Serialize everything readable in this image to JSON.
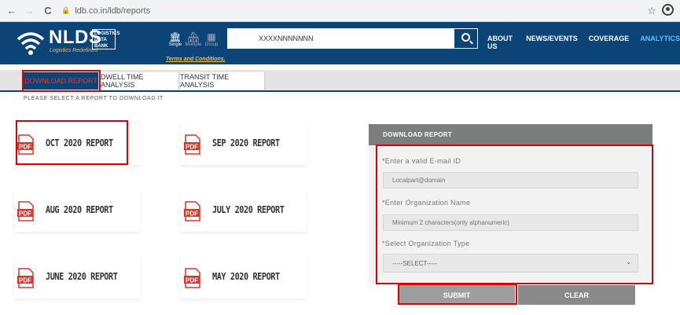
{
  "browser": {
    "back": "←",
    "forward": "→",
    "reload": "C",
    "url": "ldb.co.in/ldb/reports",
    "star": "☆"
  },
  "header": {
    "logo_text": "NLDS",
    "logo_tagline": "Logistics Redefined",
    "logo_box_lines": [
      "LOGISTICS",
      "DATA",
      "BANK"
    ],
    "modes": [
      {
        "label": "Single",
        "icon": "building-icon"
      },
      {
        "label": "Multiple",
        "icon": "buildings-icon"
      },
      {
        "label": "Group",
        "icon": "grid-icon"
      }
    ],
    "terms": "Terms and Conditions.",
    "search_value": "XXXXNNNNNNN",
    "nav": [
      "ABOUT US",
      "NEWS/EVENTS",
      "COVERAGE",
      "ANALYTICS"
    ]
  },
  "tabs": [
    {
      "label": "DOWNLOAD REPORT",
      "active": true
    },
    {
      "label": "DWELL TIME ANALYSIS",
      "active": false
    },
    {
      "label": "TRANSIT TIME ANALYSIS",
      "active": false
    }
  ],
  "hint": "PLEASE SELECT A REPORT TO DOWNLOAD IT",
  "reports": [
    "OCT 2020 REPORT",
    "SEP 2020 REPORT",
    "AUG 2020 REPORT",
    "JULY 2020 REPORT",
    "JUNE 2020 REPORT",
    "MAY 2020 REPORT"
  ],
  "pdf_label": "PDF",
  "form": {
    "title": "DOWNLOAD REPORT",
    "email_label": "*Enter a valid E-mail ID",
    "email_placeholder": "Localpart@domain",
    "org_label": "*Enter Organization Name",
    "org_placeholder": "Minimum 2 characters(only alphanumeric)",
    "type_label": "*Select Organization Type",
    "type_selected": "-----SELECT-----",
    "submit": "SUBMIT",
    "clear": "CLEAR"
  },
  "colors": {
    "brand": "#0d4477",
    "accent_red": "#e00000",
    "pdf_red": "#d9362b"
  }
}
